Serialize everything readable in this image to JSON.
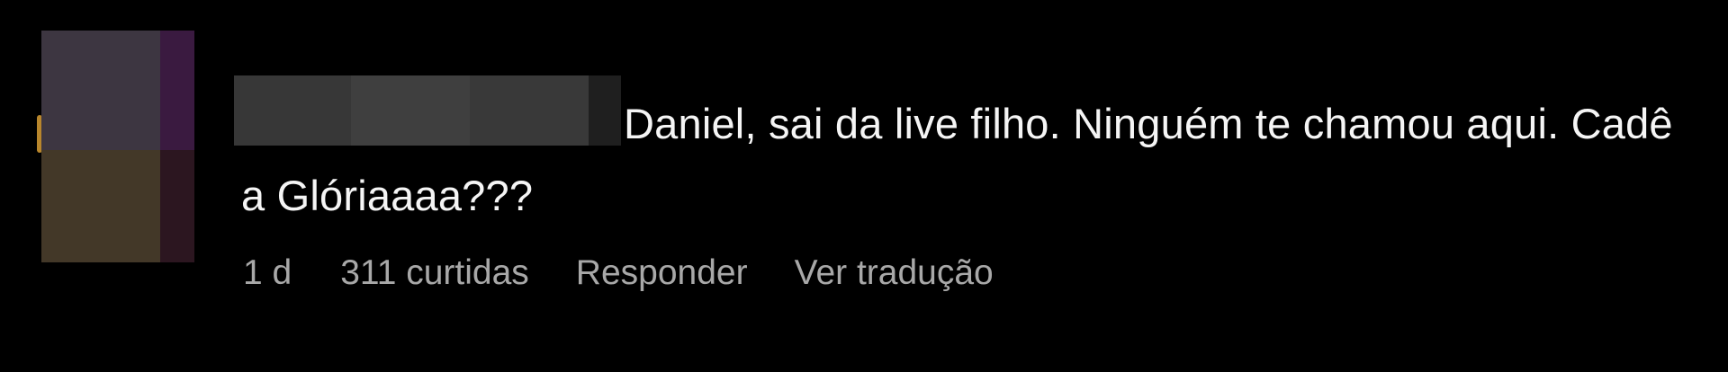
{
  "comment": {
    "text": "Daniel, sai da live filho. Ninguém te chamou aqui. Cadê a Glóriaaaa???",
    "time": "1 d",
    "likes": "311 curtidas",
    "reply_label": "Responder",
    "translate_label": "Ver tradução"
  },
  "colors": {
    "background": "#000000",
    "text": "#f5f5f5",
    "meta_text": "#a8a8a8"
  }
}
